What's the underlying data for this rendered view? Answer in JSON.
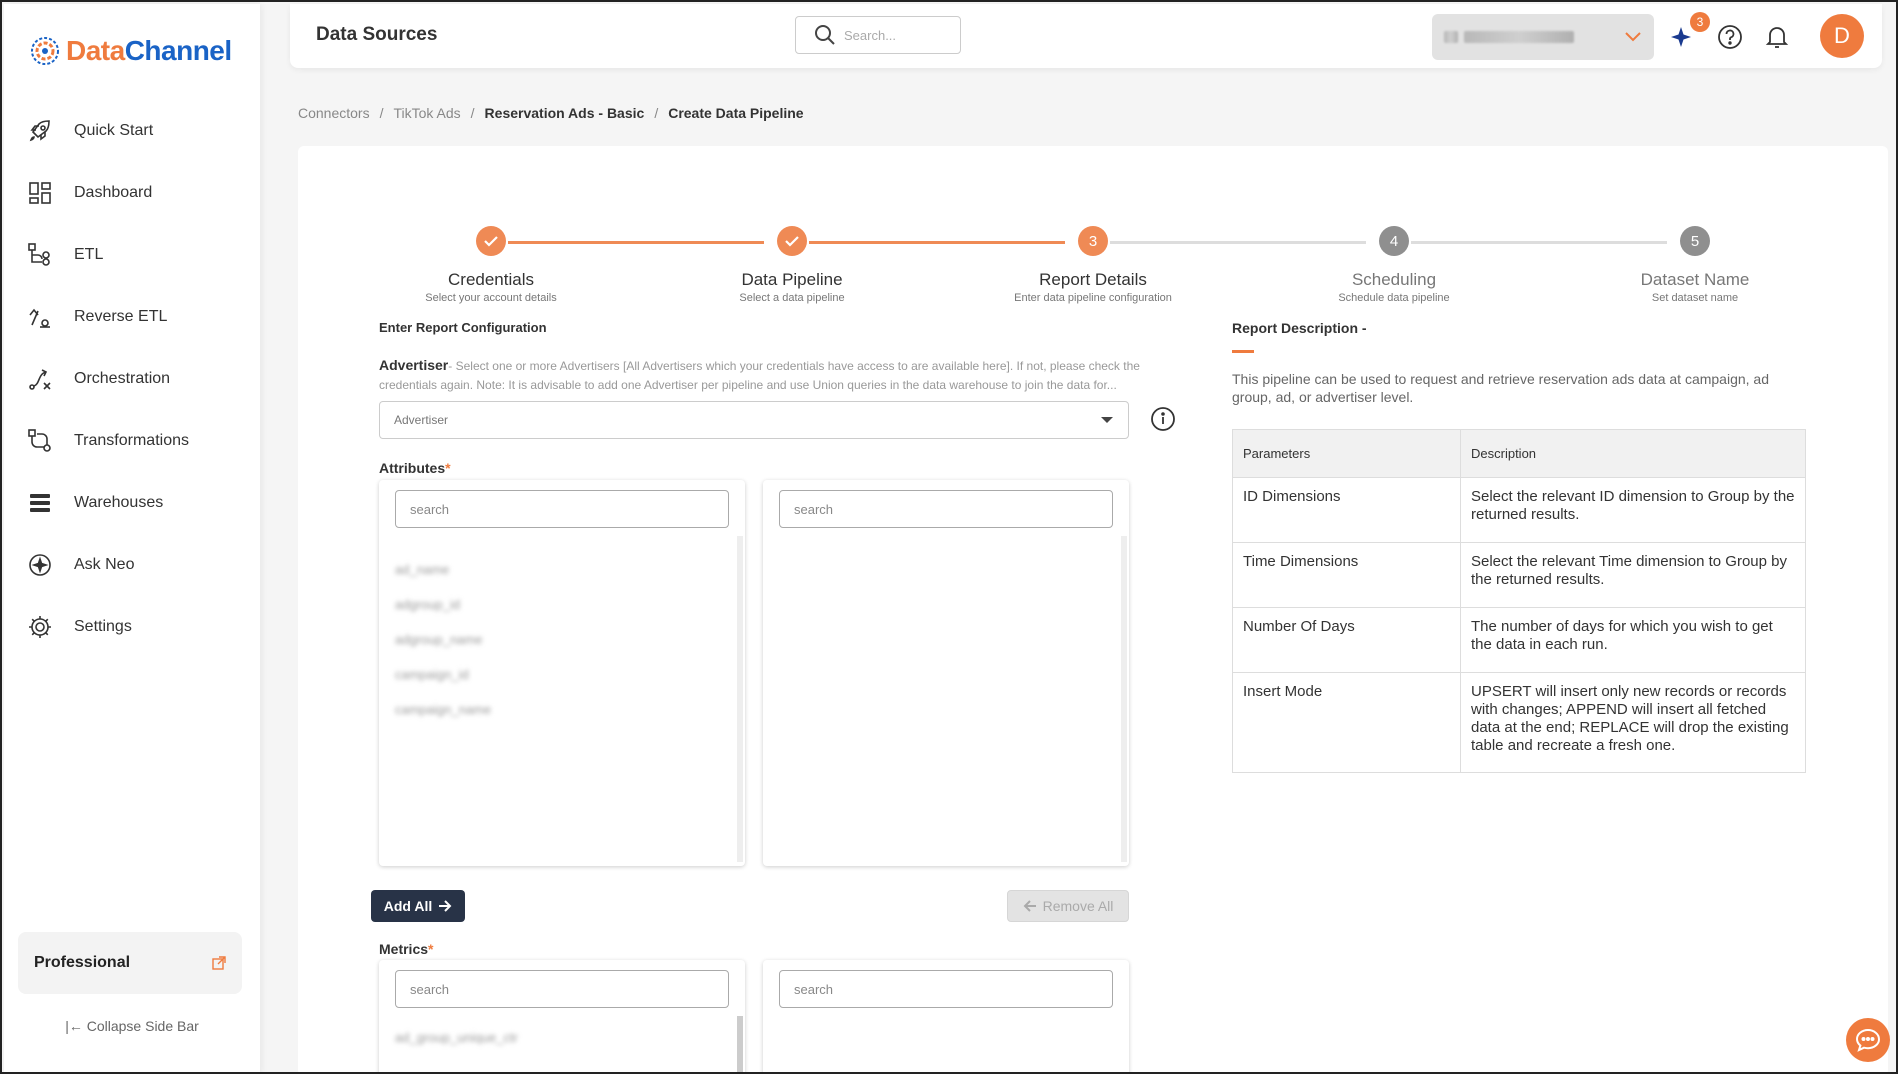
{
  "brand": {
    "name_part1": "Data",
    "name_part2": "Channel",
    "accent": "#ef7b3e",
    "secondary": "#1a63c6"
  },
  "sidebar": {
    "items": [
      {
        "label": "Quick Start",
        "icon": "rocket-icon"
      },
      {
        "label": "Dashboard",
        "icon": "dashboard-icon"
      },
      {
        "label": "ETL",
        "icon": "etl-icon"
      },
      {
        "label": "Reverse ETL",
        "icon": "reverse-etl-icon"
      },
      {
        "label": "Orchestration",
        "icon": "orchestration-icon"
      },
      {
        "label": "Transformations",
        "icon": "transformations-icon"
      },
      {
        "label": "Warehouses",
        "icon": "warehouse-icon"
      },
      {
        "label": "Ask Neo",
        "icon": "sparkle-icon"
      },
      {
        "label": "Settings",
        "icon": "gear-icon"
      }
    ],
    "plan": "Professional",
    "collapse": "Collapse Side Bar"
  },
  "header": {
    "title": "Data Sources",
    "search_placeholder": "Search...",
    "notif_badge": "3",
    "avatar_initial": "D"
  },
  "breadcrumb": [
    "Connectors",
    "TikTok Ads",
    "Reservation Ads - Basic",
    "Create Data Pipeline"
  ],
  "stepper": [
    {
      "label": "Credentials",
      "sub": "Select your account details",
      "state": "done"
    },
    {
      "label": "Data Pipeline",
      "sub": "Select a data pipeline",
      "state": "done"
    },
    {
      "label": "Report Details",
      "sub": "Enter data pipeline configuration",
      "state": "active",
      "num": "3"
    },
    {
      "label": "Scheduling",
      "sub": "Schedule data pipeline",
      "state": "inactive",
      "num": "4"
    },
    {
      "label": "Dataset Name",
      "sub": "Set dataset name",
      "state": "inactive",
      "num": "5"
    }
  ],
  "form": {
    "section_title": "Enter Report Configuration",
    "advertiser_label": "Advertiser",
    "advertiser_desc": "- Select one or more Advertisers [All Advertisers which your credentials have access to are available here]. If not, please check the credentials again. Note: It is advisable to add one Advertiser per pipeline and use Union queries in the data warehouse to join the data for...",
    "advertiser_placeholder": "Advertiser",
    "attributes_label": "Attributes",
    "metrics_label": "Metrics",
    "search_placeholder": "search",
    "attribute_items": [
      "ad_name",
      "adgroup_id",
      "adgroup_name",
      "campaign_id",
      "campaign_name"
    ],
    "metric_items": [
      "ad_group_unique_ctr"
    ],
    "add_all": "Add All",
    "remove_all": "Remove All"
  },
  "report": {
    "title": "Report Description -",
    "description": "This pipeline can be used to request and retrieve reservation ads data at campaign, ad group, ad, or advertiser level.",
    "col_params": "Parameters",
    "col_desc": "Description",
    "rows": [
      {
        "param": "ID Dimensions",
        "desc": "Select the relevant ID dimension to Group by the returned results."
      },
      {
        "param": "Time Dimensions",
        "desc": "Select the relevant Time dimension to Group by the returned results."
      },
      {
        "param": "Number Of Days",
        "desc": "The number of days for which you wish to get the data in each run."
      },
      {
        "param": "Insert Mode",
        "desc": "UPSERT will insert only new records or records with changes; APPEND will insert all fetched data at the end; REPLACE will drop the existing table and recreate a fresh one."
      }
    ]
  }
}
